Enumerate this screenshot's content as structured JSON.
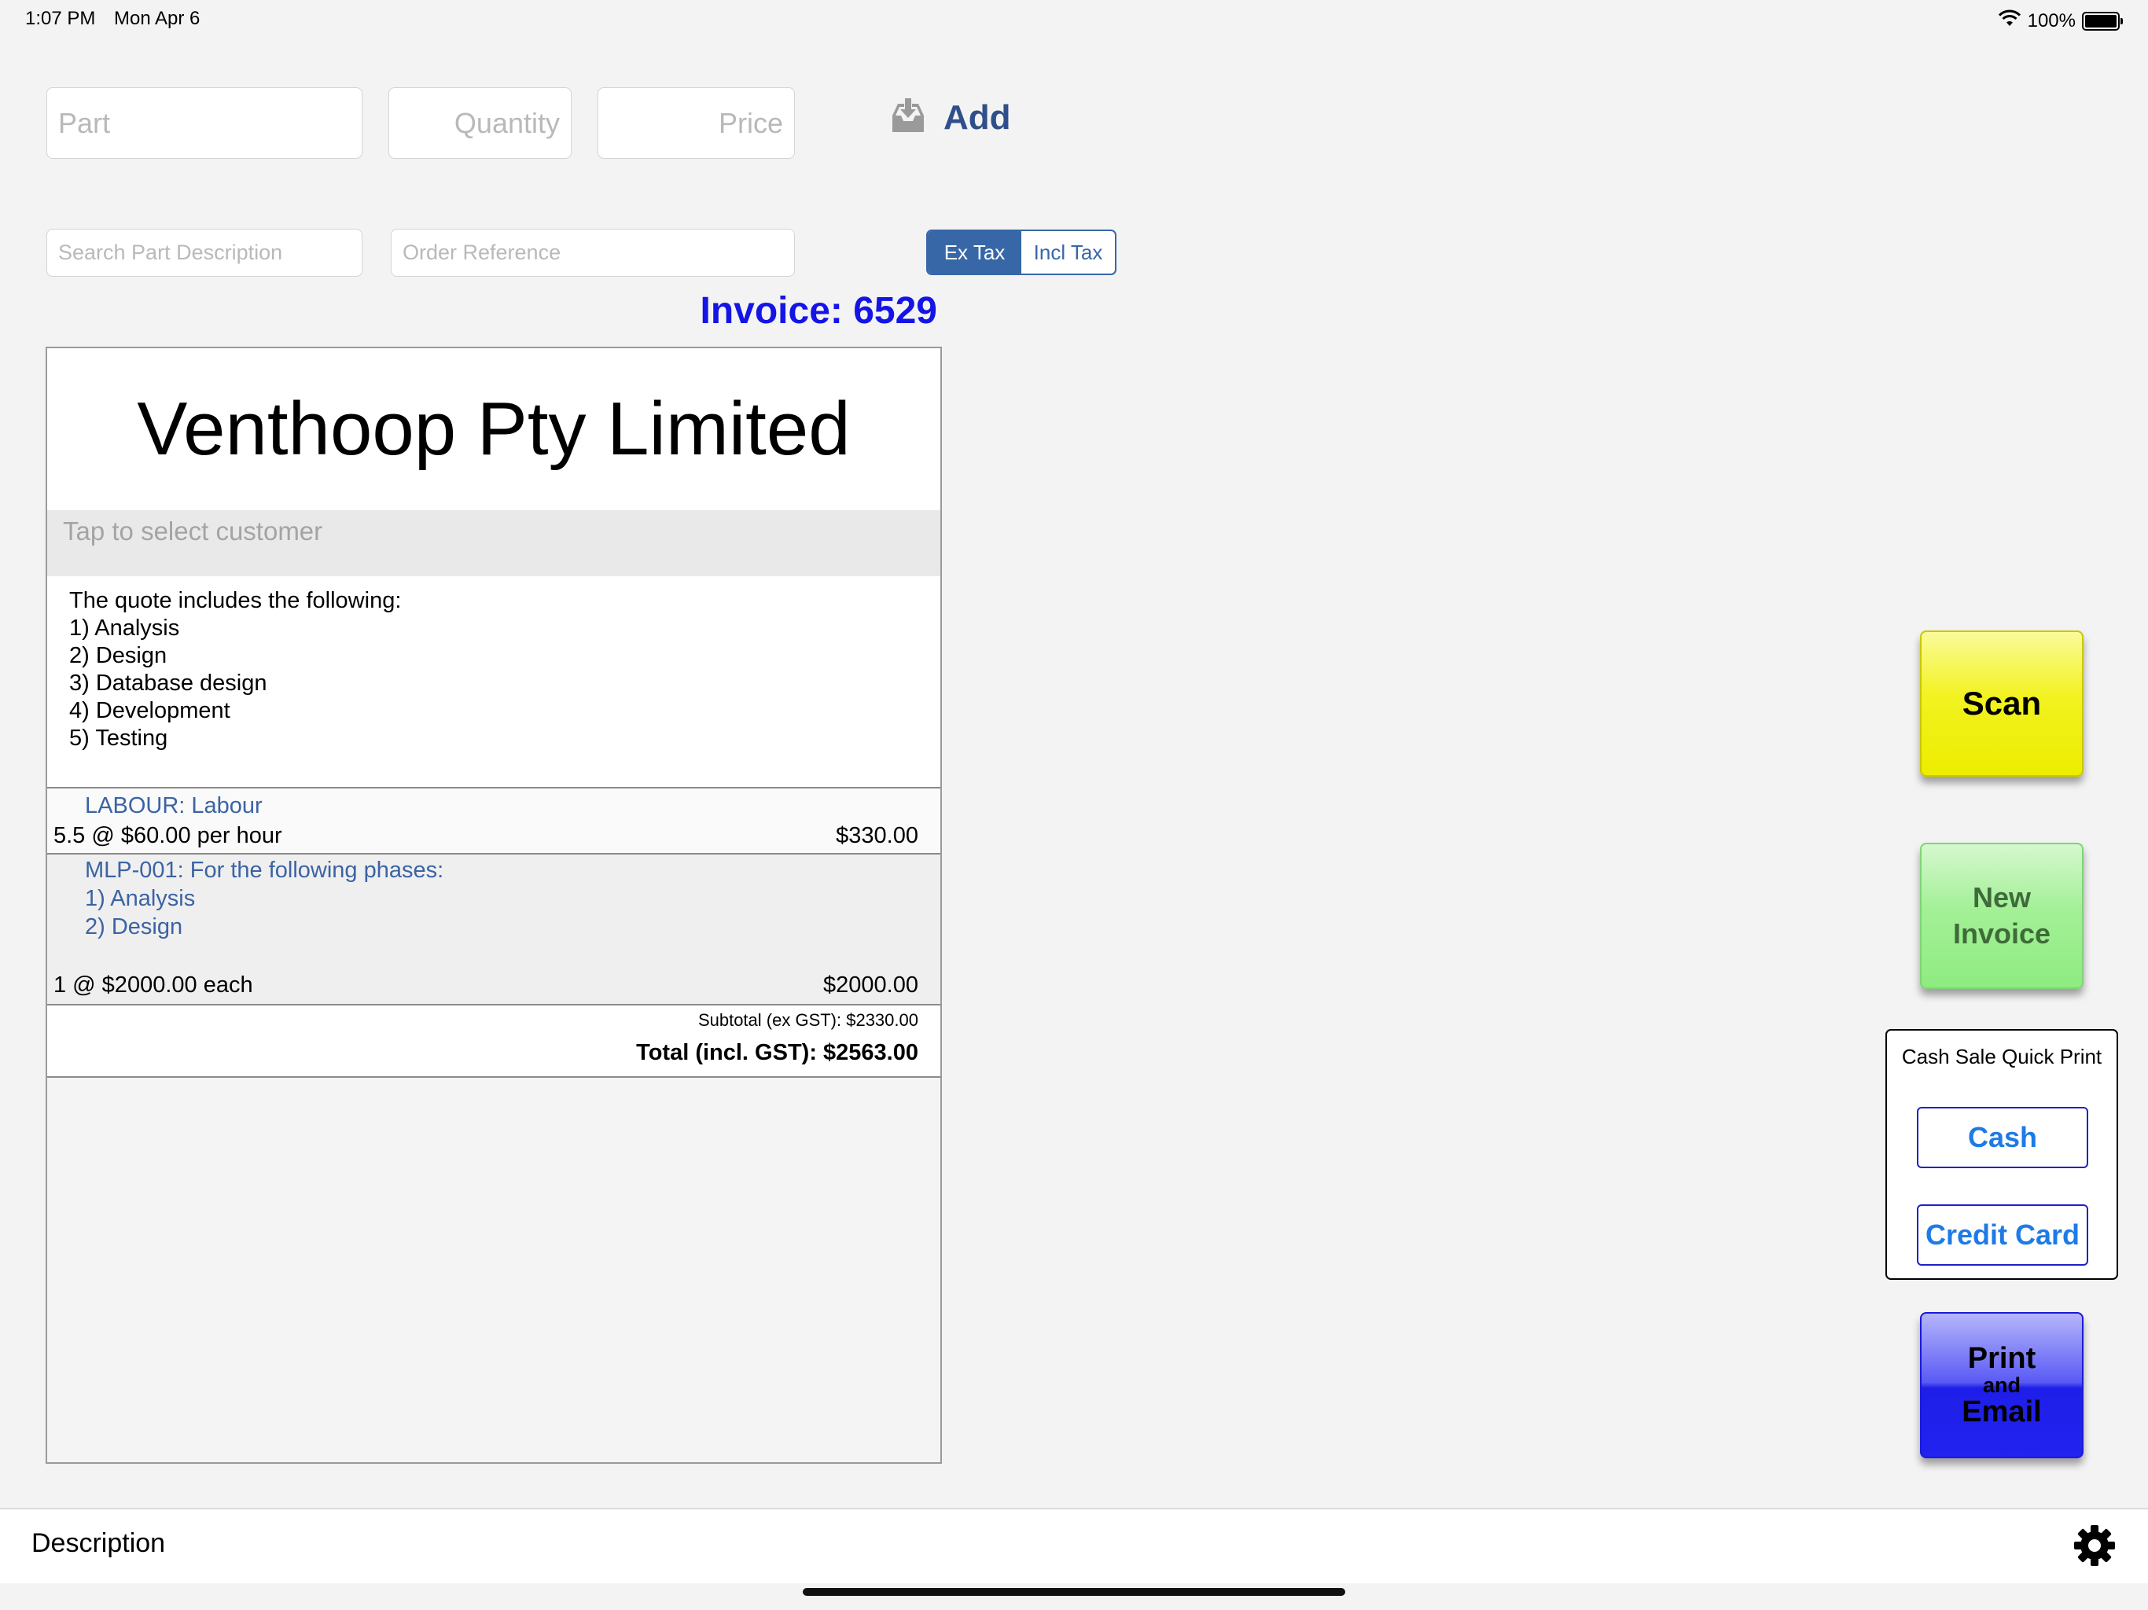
{
  "status_bar": {
    "time": "1:07 PM",
    "date": "Mon Apr 6",
    "battery": "100%",
    "battery_level": 1.0,
    "wifi_icon": "wifi-icon",
    "battery_icon": "battery-icon"
  },
  "entry": {
    "part_placeholder": "Part",
    "quantity_placeholder": "Quantity",
    "price_placeholder": "Price",
    "add_label": "Add",
    "add_icon": "inbox-download-icon",
    "search_placeholder": "Search Part Description",
    "order_ref_placeholder": "Order Reference"
  },
  "tax_toggle": {
    "options": [
      "Ex Tax",
      "Incl Tax"
    ],
    "selected": "Ex Tax"
  },
  "invoice": {
    "title": "Invoice: 6529",
    "company": "Venthoop Pty Limited",
    "customer_placeholder": "Tap to select customer",
    "notes": "The quote includes the following:\n1) Analysis\n2) Design\n3) Database design\n4) Development\n5) Testing",
    "lines": [
      {
        "description": "LABOUR: Labour",
        "qty_text": "5.5 @ $60.00 per hour",
        "amount": "$330.00"
      },
      {
        "description": "MLP-001: For the following phases:\n1) Analysis\n2) Design",
        "qty_text": "1 @ $2000.00 each",
        "amount": "$2000.00"
      }
    ],
    "subtotal": "Subtotal (ex GST):  $2330.00",
    "total": "Total (incl. GST):  $2563.00"
  },
  "actions": {
    "scan": "Scan",
    "new_invoice_line1": "New",
    "new_invoice_line2": "Invoice",
    "quick_print_title": "Cash Sale Quick Print",
    "cash": "Cash",
    "credit_card": "Credit Card",
    "print_line1": "Print",
    "print_line2": "and",
    "print_line3": "Email"
  },
  "bottom_bar": {
    "description": "Description",
    "settings_icon": "gear-icon"
  },
  "colors": {
    "accent": "#3867a8",
    "invoice_title": "#1414e6",
    "item_text": "#3b63a3",
    "scan": "#f2f220",
    "new_invoice": "#a4f097",
    "print": "#2323f0",
    "quick_button_text": "#1e7be6"
  }
}
